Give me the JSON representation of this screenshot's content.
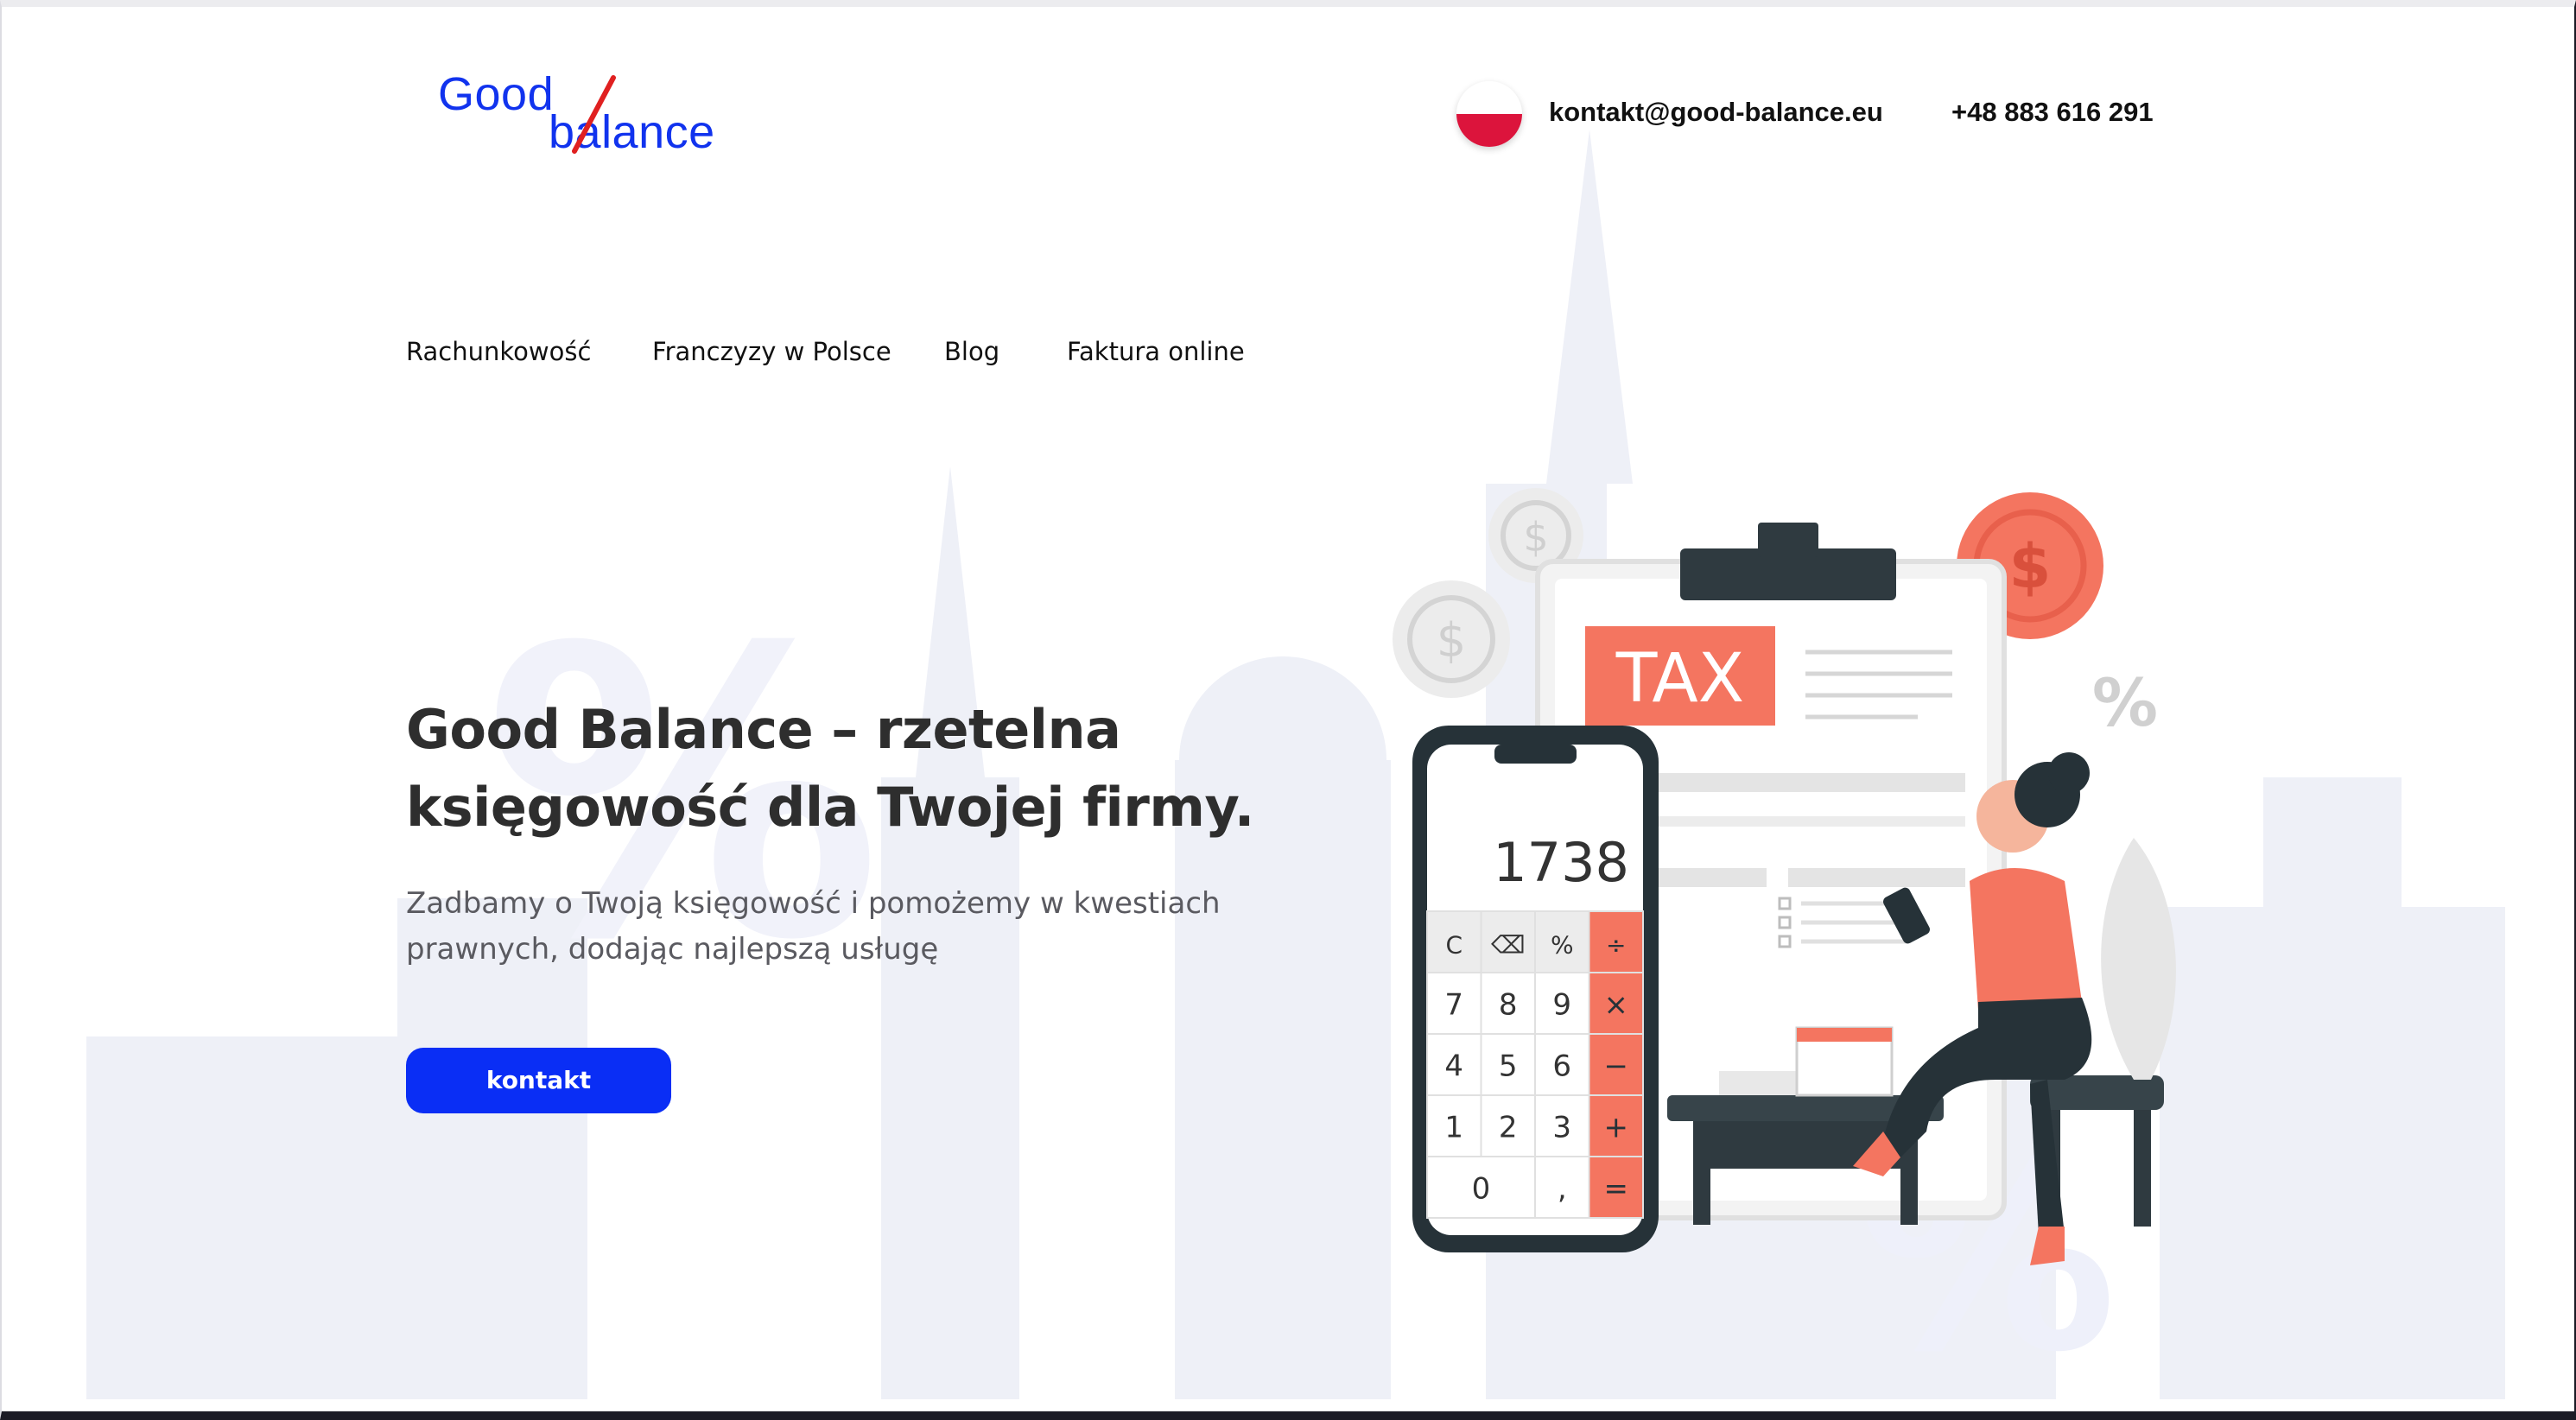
{
  "brand": {
    "logo_top": "Good",
    "logo_bottom": "balance",
    "colors": {
      "logo_blue": "#1133ee",
      "logo_red": "#e02020",
      "accent_blue": "#0a2ef5",
      "accent_coral": "#f47560"
    }
  },
  "header": {
    "language_icon": "poland-flag-icon",
    "email": "kontakt@good-balance.eu",
    "phone": "+48 883 616 291"
  },
  "nav": {
    "items": [
      {
        "label": "Rachunkowość"
      },
      {
        "label": "Franczyzy w Polsce"
      },
      {
        "label": "Blog"
      },
      {
        "label": "Faktura online"
      }
    ]
  },
  "hero": {
    "title_line1": "Good Balance – rzetelna",
    "title_line2": "księgowość dla Twojej firmy.",
    "subtitle_line1": "Zadbamy o Twoją księgowość i pomożemy w kwestiach",
    "subtitle_line2": "prawnych, dodając najlepszą usługę",
    "cta_label": "kontakt"
  },
  "illustration": {
    "tax_label": "TAX",
    "calculator_display": "1738",
    "keys": [
      [
        "C",
        "⌫",
        "%",
        "÷"
      ],
      [
        "7",
        "8",
        "9",
        "×"
      ],
      [
        "4",
        "5",
        "6",
        "−"
      ],
      [
        "1",
        "2",
        "3",
        "+"
      ],
      [
        "0",
        ",",
        "="
      ]
    ],
    "coin_symbol": "$",
    "percent_symbol": "%"
  }
}
